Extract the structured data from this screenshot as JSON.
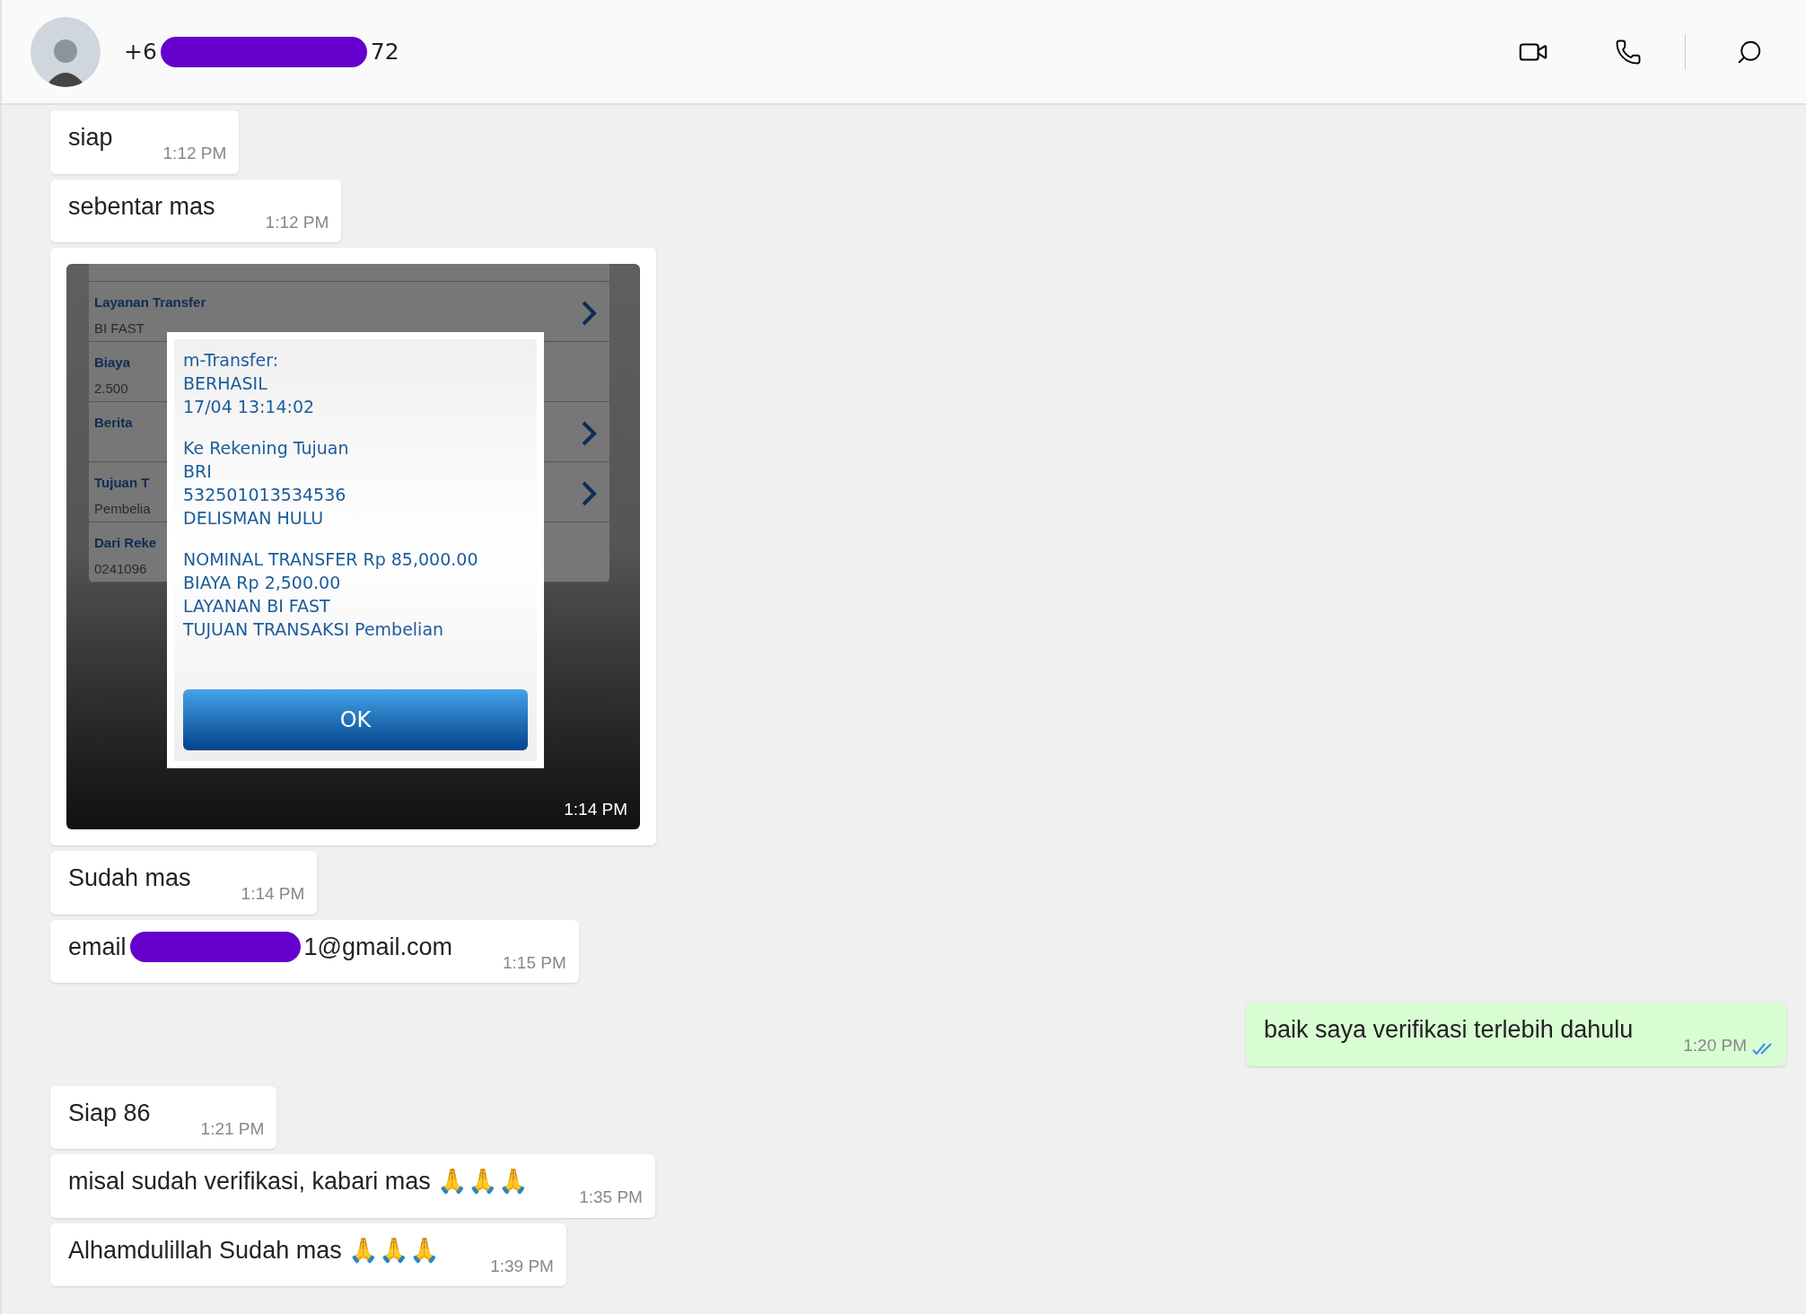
{
  "header": {
    "title_start": "+6",
    "title_end": "72"
  },
  "messages": [
    {
      "kind": "text",
      "outgoing": false,
      "text": "siap",
      "time": "1:12 PM"
    },
    {
      "kind": "text",
      "outgoing": false,
      "text": "sebentar mas",
      "time": "1:12 PM"
    },
    {
      "kind": "image",
      "outgoing": false,
      "time": "1:14 PM",
      "screenshot": {
        "rows": [
          {
            "label": "Layanan Transfer",
            "value": "BI FAST",
            "chevron": true
          },
          {
            "label": "Biaya",
            "value": "2.500",
            "chevron": false
          },
          {
            "label": "Berita",
            "chevron": true
          },
          {
            "label": "Tujuan T",
            "value": "Pembelia",
            "chevron": true
          },
          {
            "label": "Dari Reke",
            "value": "0241096",
            "chevron": false
          }
        ],
        "dialog": {
          "groups": [
            [
              "m-Transfer:",
              "BERHASIL",
              "17/04 13:14:02"
            ],
            [
              "Ke Rekening Tujuan",
              "BRI",
              "532501013534536",
              "DELISMAN HULU"
            ],
            [
              "NOMINAL TRANSFER Rp 85,000.00",
              "BIAYA Rp 2,500.00",
              "LAYANAN BI FAST",
              "TUJUAN TRANSAKSI Pembelian"
            ]
          ],
          "button": "OK"
        }
      }
    },
    {
      "kind": "text",
      "outgoing": false,
      "text": "Sudah mas",
      "time": "1:14 PM"
    },
    {
      "kind": "text",
      "outgoing": false,
      "text": "email",
      "text_after": "1@gmail.com",
      "time": "1:15 PM"
    },
    {
      "kind": "text",
      "outgoing": true,
      "text": "baik saya verifikasi terlebih dahulu",
      "time": "1:20 PM",
      "read": true
    },
    {
      "kind": "text",
      "outgoing": false,
      "text": "Siap 86",
      "time": "1:21 PM"
    },
    {
      "kind": "text",
      "outgoing": false,
      "text": "misal sudah verifikasi, kabari mas  🙏🙏🙏",
      "time": "1:35 PM"
    },
    {
      "kind": "text",
      "outgoing": false,
      "text": "Alhamdulillah Sudah mas 🙏🙏🙏",
      "time": "1:39 PM"
    }
  ]
}
